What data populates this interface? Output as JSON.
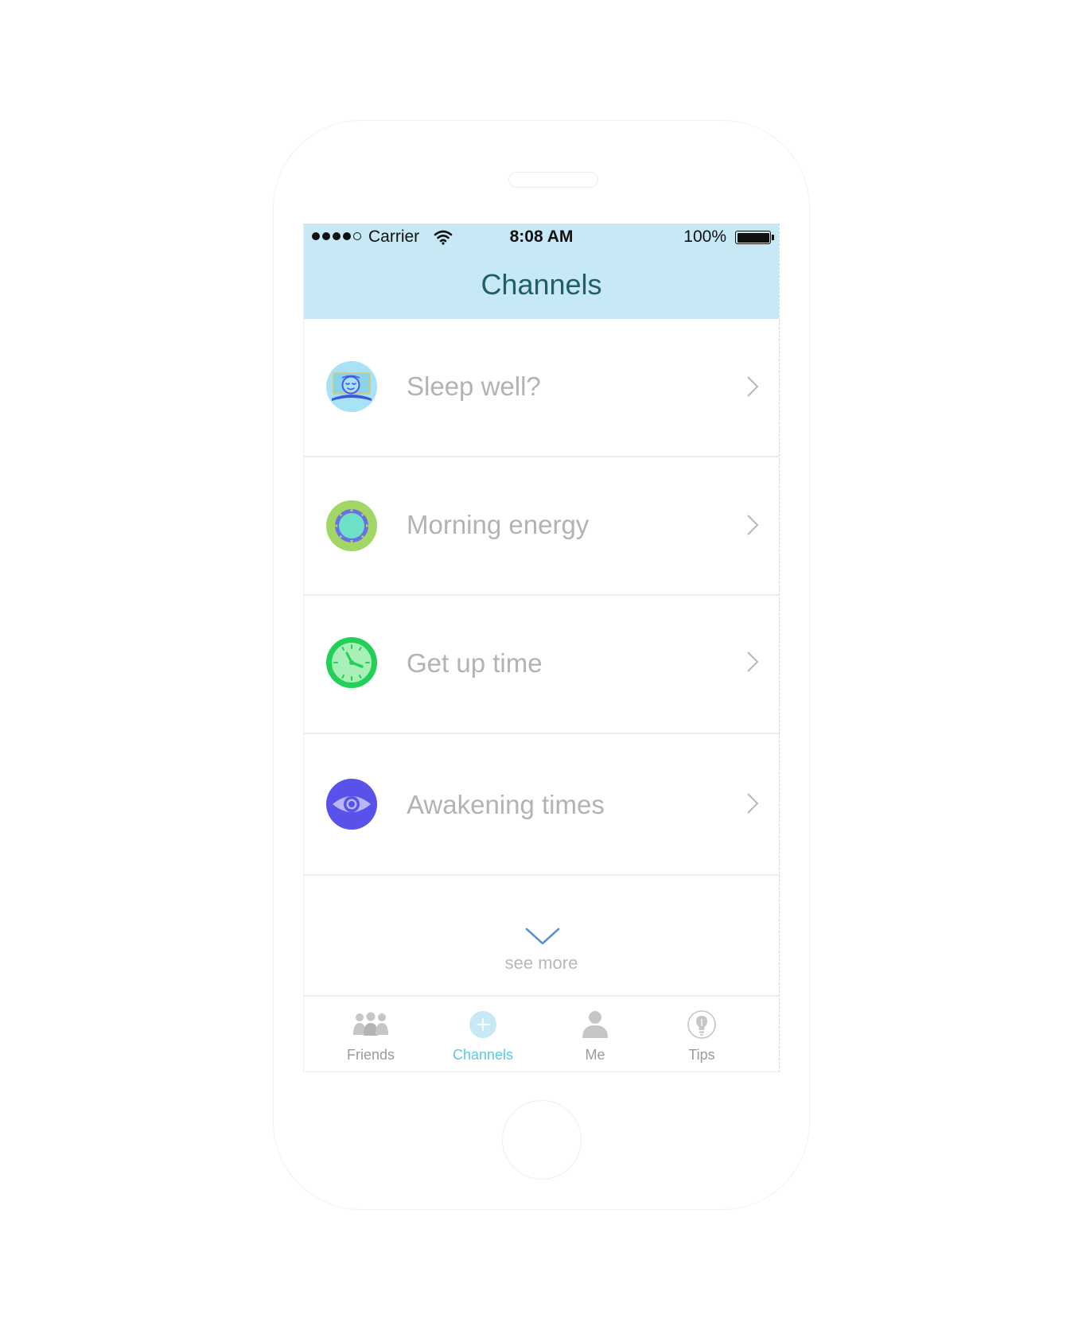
{
  "status_bar": {
    "carrier": "Carrier",
    "time": "8:08 AM",
    "battery": "100%"
  },
  "header": {
    "title": "Channels"
  },
  "channels": [
    {
      "label": "Sleep well?",
      "icon": "sleeping-face-icon",
      "color": "#a8e2f7"
    },
    {
      "label": "Morning energy",
      "icon": "sun-icon",
      "color": "#a3d765"
    },
    {
      "label": "Get up time",
      "icon": "clock-icon",
      "color": "#22cf57"
    },
    {
      "label": "Awakening times",
      "icon": "eye-icon",
      "color": "#5852ea"
    }
  ],
  "see_more": {
    "label": "see more"
  },
  "tabbar": {
    "items": [
      {
        "label": "Friends",
        "icon": "friends-icon",
        "active": false
      },
      {
        "label": "Channels",
        "icon": "plus-circle-icon",
        "active": true
      },
      {
        "label": "Me",
        "icon": "person-icon",
        "active": false
      },
      {
        "label": "Tips",
        "icon": "lightbulb-icon",
        "active": false
      }
    ]
  },
  "colors": {
    "header_bg": "#c6e9f5",
    "title_text": "#1f5f68",
    "accent": "#5ac8e8",
    "row_text": "#b3b3b3"
  }
}
